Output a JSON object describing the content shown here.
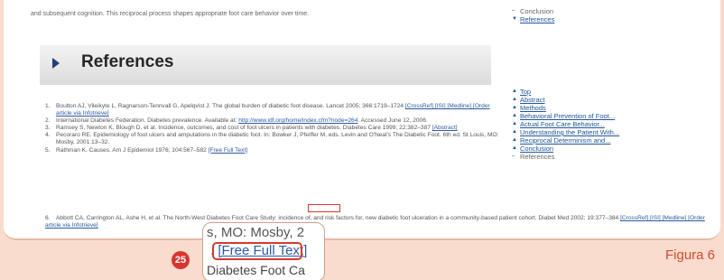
{
  "top_text": "and subsequent cognition. This reciprocal process shapes appropriate foot care behavior over time.",
  "toc_top": [
    {
      "label": "Conclusion",
      "current": true
    },
    {
      "label": "References",
      "current": false
    }
  ],
  "heading": "References",
  "toc_main": [
    {
      "label": "Top",
      "current": false
    },
    {
      "label": "Abstract",
      "current": false
    },
    {
      "label": "Methods",
      "current": false
    },
    {
      "label": "Behavioral Prevention of Foot...",
      "current": false
    },
    {
      "label": "Actual Foot Care Behavior...",
      "current": false
    },
    {
      "label": "Understanding the Patient With...",
      "current": false
    },
    {
      "label": "Reciprocal Determinism and...",
      "current": false
    },
    {
      "label": "Conclusion",
      "current": false
    },
    {
      "label": "References",
      "current": true
    }
  ],
  "references": [
    {
      "num": "1.",
      "text": "Boulton AJ, Vileikyte L, Ragnarson-Tennvall G, Apelqvist J. The global burden of diabetic foot disease. Lancet 2005; 366:1719–1724",
      "links": "[CrossRef] [ISI] [Medline] [Order article via Infotrieve]"
    },
    {
      "num": "2.",
      "text": "International Diabetes Federation. Diabetes prevalence. Available at:",
      "links": "http://www.idf.org/home/index.cfm?node=264",
      "after": ". Accessed June 12, 2006."
    },
    {
      "num": "3.",
      "text": "Ramsey S, Newton K, Blough D, et al. Incidence, outcomes, and cost of foot ulcers in patients with diabetes. Diabetes Care 1999; 22:382–387",
      "links": "[Abstract]"
    },
    {
      "num": "4.",
      "text": "Pecoraro RE. Epidemiology of foot ulcers and amputations in the diabetic foot. In: Bowker J, Pfeiffer M, eds. Levin and O'Neal's The Diabetic Foot. 6th ed. St Louis, MO: Mosby, 2001:13–32.",
      "links": ""
    },
    {
      "num": "5.",
      "text": "Rathman K. Causes. Am J Epidemiol 1976; 104:567–582",
      "links": "[Free Full Text]"
    }
  ],
  "ref6": {
    "num": "6.",
    "text": "Abbott CA, Carrington AL, Ashe H, et al. The North-West Diabetes Foot Care Study: incidence of, and risk factors for, new diabetic foot ulceration in a community-based patient cohort. Diabet Med 2002; 19:377–384",
    "links": "[CrossRef] [ISI] [Medline] [Order article via Infotrieve]"
  },
  "magnifier": {
    "line1": "s, MO: Mosby, 2",
    "prefix": ". ",
    "link": "[Free Full Text]",
    "line3": "Diabetes Foot Ca"
  },
  "badge": "25",
  "figure_label": "Figura 6",
  "colors": {
    "accent": "#d9352f",
    "link": "#2c5aa0",
    "background": "#f9dccd"
  }
}
